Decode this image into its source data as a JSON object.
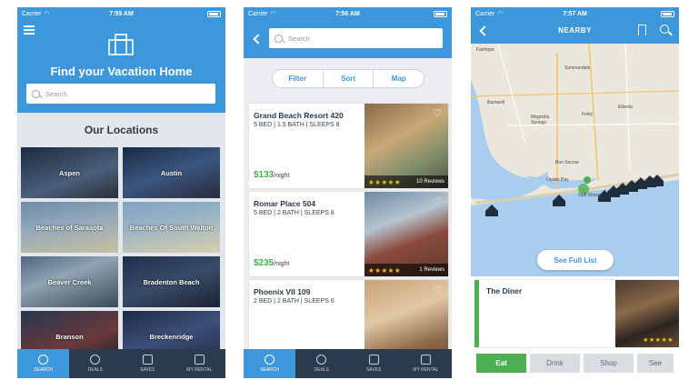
{
  "colors": {
    "primary": "#3d97db",
    "tabbar": "#2b3a4d",
    "price_green": "#3fb24e",
    "star": "#f4c20d",
    "active_category": "#4caf50"
  },
  "status": {
    "carrier": "Carrier",
    "times": [
      "7:55 AM",
      "7:56 AM",
      "7:57 AM"
    ]
  },
  "screen1": {
    "menu_icon": "hamburger-icon",
    "logo_icon": "house-icon",
    "title": "Find your Vacation Home",
    "search_placeholder": "Search",
    "section_title": "Our Locations",
    "locations": [
      "Aspen",
      "Austin",
      "Beaches of Sarasota",
      "Beaches Of South Walton",
      "Beaver Creek",
      "Bradenton Beach",
      "Branson",
      "Breckenridge"
    ]
  },
  "tabs": [
    {
      "label": "SEARCH",
      "icon": "search-icon"
    },
    {
      "label": "DEALS",
      "icon": "money-bag-icon"
    },
    {
      "label": "SAVES",
      "icon": "saves-icon"
    },
    {
      "label": "MY RENTAL",
      "icon": "handshake-icon"
    }
  ],
  "screen2": {
    "search_placeholder": "Search",
    "segments": [
      "Filter",
      "Sort",
      "Map"
    ],
    "listings": [
      {
        "name": "Grand Beach Resort 420",
        "specs": "5 BED | 1.5 BATH | SLEEPS 8",
        "price": "$133",
        "per": "/night",
        "stars": "★★★★★",
        "reviews": "10 Reviews"
      },
      {
        "name": "Romar Place 504",
        "specs": "5 BED | 2 BATH | SLEEPS 8",
        "price": "$235",
        "per": "/night",
        "stars": "★★★★★",
        "reviews": "1 Reviews"
      },
      {
        "name": "Phoenix VII 109",
        "specs": "2 BED | 2 BATH | SLEEPS 6",
        "price": "",
        "per": "",
        "stars": "",
        "reviews": ""
      }
    ]
  },
  "screen3": {
    "title": "NEARBY",
    "map_labels": [
      "Fairhope",
      "Summerdale",
      "Barnwell",
      "Magnolia Springs",
      "Foley",
      "Elberta",
      "Bon Secour",
      "Oyster Bay",
      "Gulf Shores"
    ],
    "see_full_list": "See Full List",
    "place": {
      "name": "The Diner",
      "stars": "★★★★★"
    },
    "categories": [
      "Eat",
      "Drink",
      "Shop",
      "See"
    ]
  }
}
